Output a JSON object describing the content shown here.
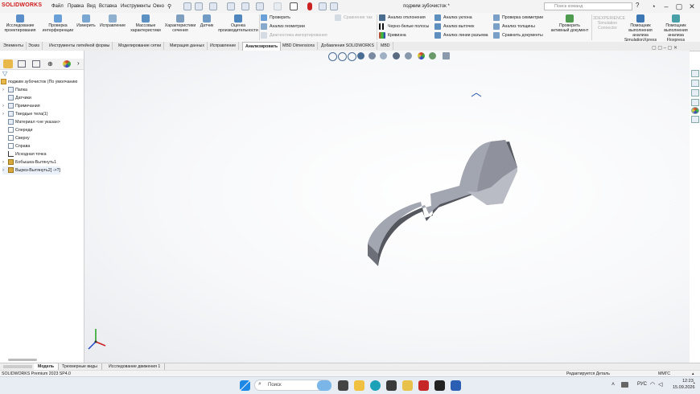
{
  "app": {
    "logo": "SOLIDWORKS",
    "document_title": "поджим зубочисток *",
    "search_placeholder": "Поиск команд",
    "menu": [
      "Файл",
      "Правка",
      "Вид",
      "Вставка",
      "Инструменты",
      "Окно"
    ]
  },
  "ribbon": {
    "big_buttons": [
      {
        "label": "Исследование проектирования",
        "icon": "study-icon"
      },
      {
        "label": "Проверка интерференции",
        "icon": "interference-icon"
      },
      {
        "label": "Измерить",
        "icon": "measure-icon"
      },
      {
        "label": "Исправление",
        "icon": "repair-icon"
      },
      {
        "label": "Массовые характеристики",
        "icon": "mass-properties-icon"
      },
      {
        "label": "Характеристики сечения",
        "icon": "section-properties-icon"
      },
      {
        "label": "Датчик",
        "icon": "sensor-icon"
      },
      {
        "label": "Оценка производительности",
        "icon": "performance-icon"
      }
    ],
    "small_col1": [
      "Проверить",
      "Анализ геометрии",
      "Диагностика импортирования"
    ],
    "small_col2_top": "Сравнение так",
    "small_col3": [
      "Анализ отклонения",
      "Черно-белые полосы",
      "Кривизна"
    ],
    "small_col4": [
      "Анализ уклона",
      "Анализ выточек",
      "Анализ линии разъема"
    ],
    "small_col5": [
      "Проверка симметрии",
      "Анализ толщины",
      "Сравнить документы"
    ],
    "right_buttons": [
      {
        "label": "Проверить активный документ"
      },
      {
        "label": "3DEXPERIENCE Simulation Connector"
      },
      {
        "label": "Помощник выполнения анализа SimulationXpress"
      },
      {
        "label": "Помощник выполнения анализа Floxpress"
      }
    ]
  },
  "tabs": [
    "Элементы",
    "Эскиз",
    "Инструменты литейной формы",
    "Моделирование сетки",
    "Миграция данных",
    "Исправление",
    "Анализировать",
    "MBD Dimensions",
    "Добавления SOLIDWORKS",
    "MBD"
  ],
  "active_tab": "Анализировать",
  "tree": {
    "root": "поджим зубочисток (По умолчанию",
    "items": [
      {
        "label": "Папка",
        "expandable": true
      },
      {
        "label": "Датчики",
        "expandable": false
      },
      {
        "label": "Примечания",
        "expandable": true
      },
      {
        "label": "Твердые тела(1)",
        "expandable": true
      },
      {
        "label": "Материал <не указан>",
        "expandable": false
      },
      {
        "label": "Спереди",
        "expandable": false
      },
      {
        "label": "Сверху",
        "expandable": false
      },
      {
        "label": "Справа",
        "expandable": false
      },
      {
        "label": "Исходная точка",
        "expandable": false
      },
      {
        "label": "Бобышка-Вытянуть1",
        "expandable": true
      },
      {
        "label": "Вырез-Вытянуть2[ ->?]",
        "expandable": true
      }
    ]
  },
  "bottom_tabs": [
    "Модель",
    "Трехмерные виды",
    "Исследование движения 1"
  ],
  "active_bottom_tab": "Модель",
  "status": {
    "left": "SOLIDWORKS Premium 2023 SP4.0",
    "editing": "Редактируется Деталь",
    "units": "MMГС"
  },
  "taskbar": {
    "search": "Поиск",
    "lang": "РУС",
    "time": "12:23",
    "date": "15.09.2026"
  },
  "colors": {
    "accent": "#d01a1a",
    "part_face": "#9a9ea8",
    "part_dark": "#50525a",
    "part_light": "#c9ccd3"
  }
}
